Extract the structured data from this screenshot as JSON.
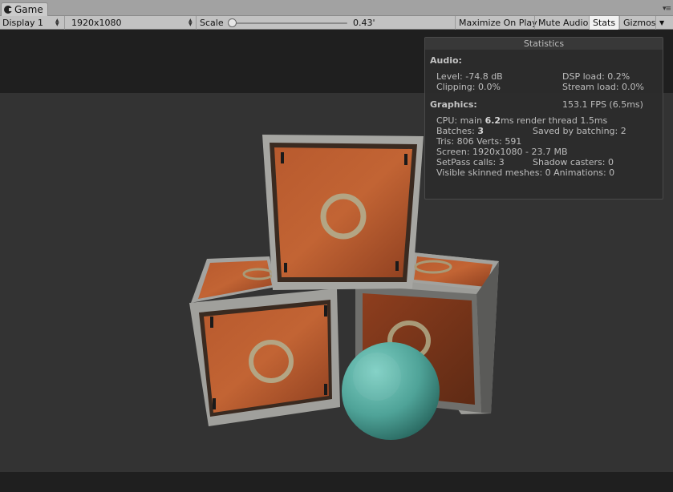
{
  "window": {
    "tab_label": "Game",
    "tab_icon": "pacman-game-icon",
    "menu_icon": "window-menu-icon"
  },
  "toolbar": {
    "display_label": "Display 1",
    "resolution_label": "1920x1080",
    "scale_label": "Scale",
    "scale_value": "0.43'",
    "scale_fraction": 0.03,
    "maximize_label": "Maximize On Play",
    "mute_label": "Mute Audio",
    "stats_label": "Stats",
    "gizmos_label": "Gizmos"
  },
  "stats": {
    "title": "Statistics",
    "audio_header": "Audio:",
    "level": "Level: -74.8 dB",
    "dsp_load": "DSP load: 0.2%",
    "clipping": "Clipping: 0.0%",
    "stream_load": "Stream load: 0.0%",
    "graphics_header": "Graphics:",
    "fps": "153.1 FPS (6.5ms)",
    "cpu_prefix": "CPU: main ",
    "cpu_main": "6.2",
    "cpu_suffix": "ms  render thread 1.5ms",
    "batches_prefix": "Batches: ",
    "batches": "3",
    "saved_batching": "Saved by batching: 2",
    "tris": "Tris: 806  Verts: 591",
    "screen": "Screen: 1920x1080 - 23.7 MB",
    "setpass": "SetPass calls: 3",
    "shadow_casters": "Shadow casters: 0",
    "skinned": "Visible skinned meshes: 0  Animations: 0"
  },
  "colors": {
    "crate_rust": "#b0532c",
    "crate_frame": "#a8a8a4",
    "sphere": "#5fb0a6",
    "scene_bg": "#333333"
  }
}
